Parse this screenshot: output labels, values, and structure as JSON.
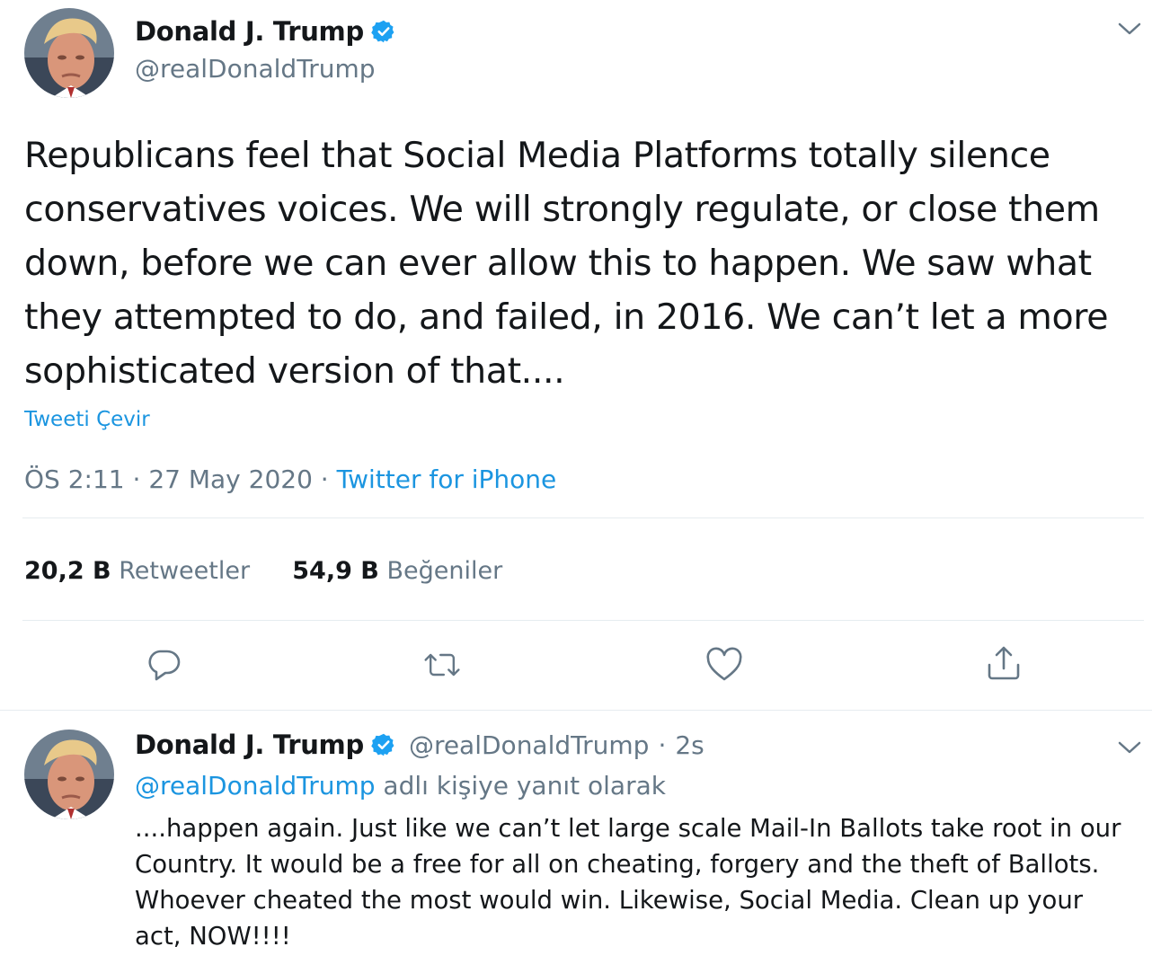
{
  "tweet": {
    "author_name": "Donald J. Trump",
    "author_handle": "@realDonaldTrump",
    "text": "Republicans feel that Social Media Platforms totally silence conservatives voices. We will strongly regulate, or close them down, before we can ever allow this to happen. We saw what they attempted to do, and failed, in 2016. We can’t let a more sophisticated version of that....",
    "translate_label": "Tweeti Çevir",
    "time": "ÖS 2:11",
    "date": "27 May 2020",
    "separator": "·",
    "source": "Twitter for iPhone",
    "retweet_count": "20,2 B",
    "retweet_label": "Retweetler",
    "like_count": "54,9 B",
    "like_label": "Beğeniler",
    "actions": [
      "reply-icon",
      "retweet-icon",
      "like-icon",
      "share-icon"
    ]
  },
  "reply": {
    "author_name": "Donald J. Trump",
    "author_handle": "@realDonaldTrump",
    "separator": "·",
    "time": "2s",
    "context_mention": "@realDonaldTrump",
    "context_suffix": " adlı kişiye yanıt olarak",
    "text": "....happen again. Just like we can’t let large scale Mail-In Ballots take root in our Country. It would be a free for all on cheating, forgery and the theft of Ballots. Whoever cheated the most would win. Likewise, Social Media. Clean up your act, NOW!!!!"
  },
  "colors": {
    "accent": "#1b95e0",
    "verified": "#1da1f2",
    "muted": "#657786",
    "text": "#14171a",
    "divider": "#e6ecf0"
  }
}
